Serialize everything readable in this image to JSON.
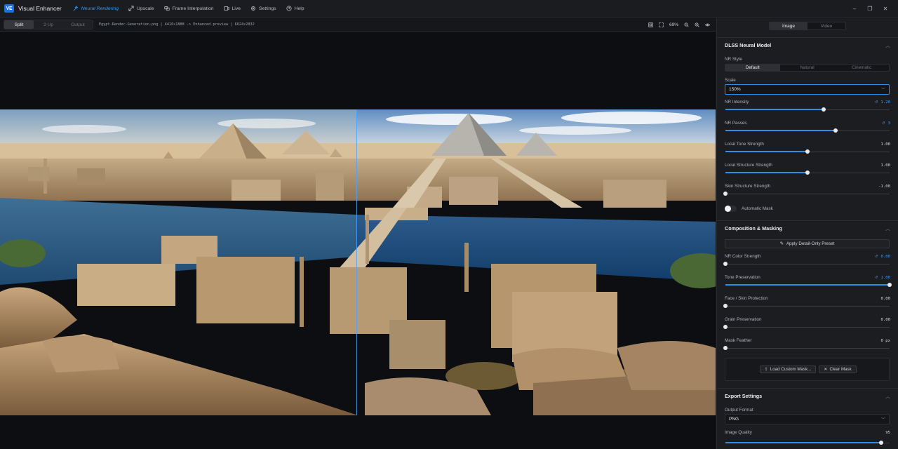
{
  "app": {
    "logo": "VE",
    "title": "Visual Enhancer"
  },
  "nav": [
    {
      "label": "Neural Rendering",
      "icon": "wand-icon",
      "active": true
    },
    {
      "label": "Upscale",
      "icon": "expand-icon",
      "active": false
    },
    {
      "label": "Frame Interpolation",
      "icon": "frames-icon",
      "active": false
    },
    {
      "label": "Live",
      "icon": "live-icon",
      "active": false
    },
    {
      "label": "Settings",
      "icon": "gear-icon",
      "active": false
    },
    {
      "label": "Help",
      "icon": "help-icon",
      "active": false
    }
  ],
  "window_controls": {
    "minimize": "‒",
    "restore": "❐",
    "close": "✕"
  },
  "viewer": {
    "view_modes": [
      "Split",
      "2-Up",
      "Output"
    ],
    "active_view": "Split",
    "file_info": "Egypt-Render-Generation.png | 4416×1888  ->  Enhanced preview | 6624×2832",
    "zoom": "69%"
  },
  "panel": {
    "mode_tabs": [
      "Image",
      "Video"
    ],
    "active_mode": "Image",
    "dlss": {
      "title": "DLSS Neural Model",
      "nr_style_label": "NR Style",
      "nr_styles": [
        "Default",
        "Natural",
        "Cinematic"
      ],
      "scale_label": "Scale",
      "scale_value": "150%",
      "sliders": [
        {
          "label": "NR Intensity",
          "value": "1.20",
          "resettable": true,
          "fraction": 0.6
        },
        {
          "label": "NR Passes",
          "value": "3",
          "resettable": true,
          "fraction": 0.67
        },
        {
          "label": "Local Tone Strength",
          "value": "1.00",
          "resettable": false,
          "fraction": 0.5
        },
        {
          "label": "Local Structure Strength",
          "value": "1.00",
          "resettable": false,
          "fraction": 0.5
        },
        {
          "label": "Skin Structure Strength",
          "value": "-1.00",
          "resettable": false,
          "fraction": 0.0
        }
      ],
      "auto_mask_label": "Automatic Mask"
    },
    "composition": {
      "title": "Composition & Masking",
      "preset_button": "Apply Detail-Only Preset",
      "sliders": [
        {
          "label": "NR Color Strength",
          "value": "0.00",
          "resettable": true,
          "fraction": 0.0
        },
        {
          "label": "Tone Preservation",
          "value": "1.00",
          "resettable": true,
          "fraction": 1.0
        },
        {
          "label": "Face / Skin Protection",
          "value": "0.00",
          "resettable": false,
          "fraction": 0.0
        },
        {
          "label": "Grain Preservation",
          "value": "0.00",
          "resettable": false,
          "fraction": 0.0
        },
        {
          "label": "Mask Feather",
          "value": "0 px",
          "resettable": false,
          "fraction": 0.0
        }
      ],
      "load_mask_button": "Load Custom Mask...",
      "clear_mask_button": "Clear Mask"
    },
    "export": {
      "title": "Export Settings",
      "format_label": "Output Format",
      "format_value": "PNG",
      "quality_label": "Image Quality",
      "quality_value": "95",
      "quality_fraction": 0.95
    }
  },
  "colors": {
    "accent": "#2f8fe6",
    "active_nav": "#2f9bff"
  }
}
